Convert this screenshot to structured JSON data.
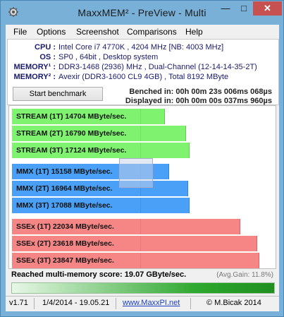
{
  "title": "MaxxMEM² - PreView - Multi",
  "window_buttons": {
    "minimize": "—",
    "maximize": "□",
    "close": "✕"
  },
  "menu": [
    "File",
    "Options",
    "Screenshot",
    "Comparisons",
    "Help"
  ],
  "info": [
    {
      "label": "CPU :",
      "value": "Intel Core i7 4770K , 4204 MHz  [NB: 4003 MHz]"
    },
    {
      "label": "OS :",
      "value": "SP0 , 64bit , Desktop system"
    },
    {
      "label": "MEMORY¹ :",
      "value": "DDR3-1468 (2936) MHz , Dual-Channel (12-14-14-35-2T)"
    },
    {
      "label": "MEMORY² :",
      "value": "Avexir (DDR3-1600 CL9 4GB) , Total 8192 MByte"
    }
  ],
  "start_button": "Start benchmark",
  "benched": "Benched in: 00h 00m 23s 006ms 068µs",
  "displayed": "Displayed in: 00h 00m 00s 037ms 960µs",
  "bars": [
    {
      "label": "STREAM (1T) 14704 MByte/sec.",
      "color": "green",
      "fraction": 0.594
    },
    {
      "label": "STREAM (2T) 16790 MByte/sec.",
      "color": "green",
      "fraction": 0.677
    },
    {
      "label": "STREAM (3T) 17124 MByte/sec.",
      "color": "green",
      "fraction": 0.69
    },
    {
      "label": "MMX (1T) 15158 MByte/sec.",
      "color": "blue",
      "fraction": 0.611
    },
    {
      "label": "MMX (2T) 16964 MByte/sec.",
      "color": "blue",
      "fraction": 0.684
    },
    {
      "label": "MMX (3T) 17088 MByte/sec.",
      "color": "blue",
      "fraction": 0.689
    },
    {
      "label": "SSEx (1T) 22034 MByte/sec.",
      "color": "red",
      "fraction": 0.888
    },
    {
      "label": "SSEx (2T) 23618 MByte/sec.",
      "color": "red",
      "fraction": 0.952
    },
    {
      "label": "SSEx (3T) 23847 MByte/sec.",
      "color": "red",
      "fraction": 0.962
    }
  ],
  "score": "Reached multi-memory score: 19.07 GByte/sec.",
  "avg_gain": "(Avg.Gain: 11.8%)",
  "progress_fraction": 1.0,
  "status": {
    "version": "v1.71",
    "date": "1/4/2014 - 19.05.21",
    "url": "www.MaxxPI.net",
    "copyright": "© M.Bicak 2014"
  },
  "colors": {
    "titlebar": "#79b0d8",
    "close": "#c75050",
    "green": "#7ff26f",
    "blue": "#4aa0f6",
    "red": "#f68686"
  }
}
